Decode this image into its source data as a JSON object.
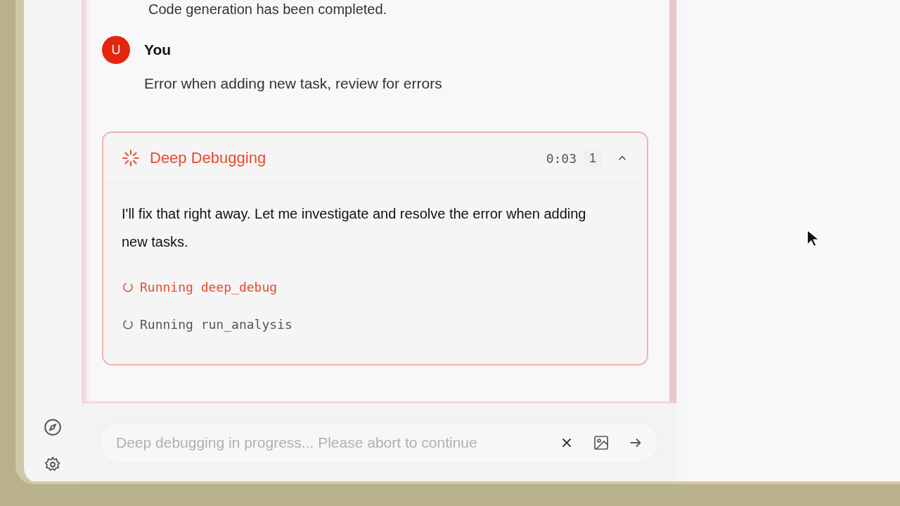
{
  "messages": [
    {
      "kind": "assistant_tail",
      "text": "Code generation has been completed."
    },
    {
      "kind": "user",
      "avatar": "U",
      "author": "You",
      "text": "Error when adding new task, review for errors"
    }
  ],
  "debug_panel": {
    "title": "Deep Debugging",
    "timer": "0:03",
    "count": "1",
    "expanded": true,
    "message": "I'll fix that right away. Let me investigate and resolve the error when adding new tasks.",
    "steps": [
      {
        "label": "Running deep_debug",
        "active": true
      },
      {
        "label": "Running run_analysis",
        "active": false
      }
    ]
  },
  "composer": {
    "placeholder": "Deep debugging in progress... Please abort to continue",
    "disabled": true
  }
}
